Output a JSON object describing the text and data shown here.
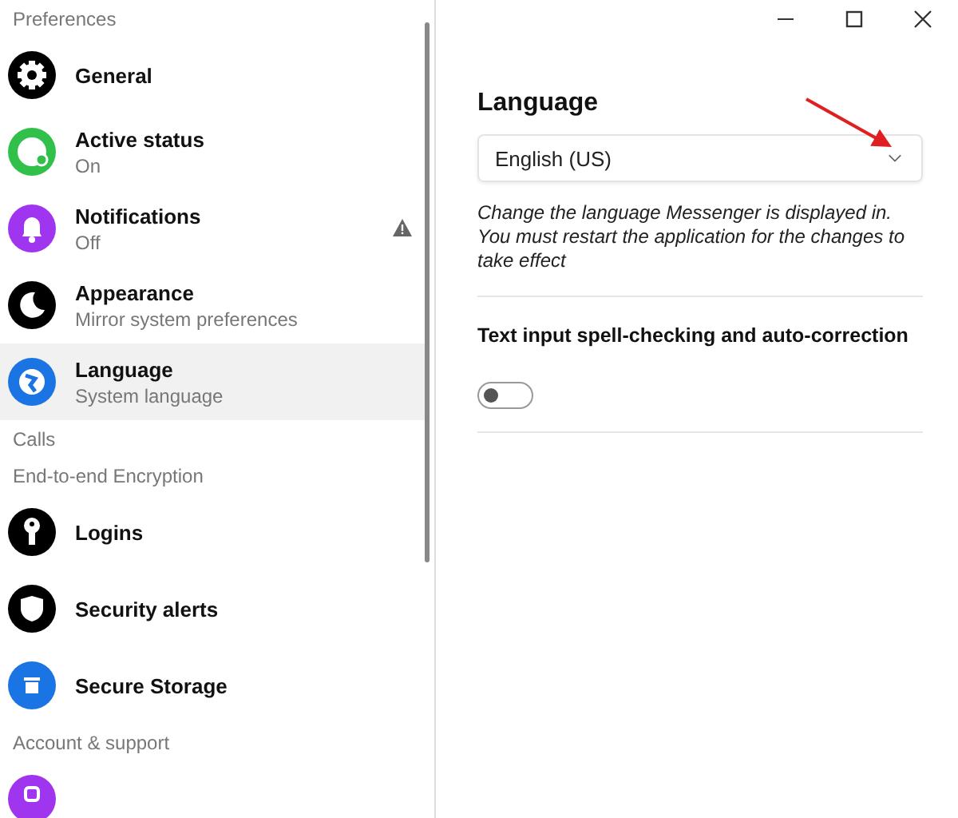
{
  "sidebar": {
    "items": [
      {
        "kind": "header",
        "title": "Preferences"
      },
      {
        "kind": "item",
        "title": "General",
        "color": "#000000",
        "selected": false,
        "warning": false
      },
      {
        "kind": "item",
        "title": "Active status",
        "subtitle": "On",
        "color": "#31c14b",
        "selected": false,
        "warning": false
      },
      {
        "kind": "item",
        "title": "Notifications",
        "subtitle": "Off",
        "color": "#a035f0",
        "selected": false,
        "warning": true
      },
      {
        "kind": "item",
        "title": "Appearance",
        "subtitle": "Mirror system preferences",
        "color": "#000000",
        "selected": false,
        "warning": false
      },
      {
        "kind": "item",
        "title": "Language",
        "subtitle": "System language",
        "color": "#1b74e4",
        "selected": true,
        "warning": false
      },
      {
        "kind": "header",
        "title": "Calls"
      },
      {
        "kind": "header",
        "title": "End-to-end Encryption"
      },
      {
        "kind": "item",
        "title": "Logins",
        "color": "#000000",
        "selected": false,
        "warning": false
      },
      {
        "kind": "item",
        "title": "Security alerts",
        "color": "#000000",
        "selected": false,
        "warning": false
      },
      {
        "kind": "item",
        "title": "Secure Storage",
        "color": "#1b74e4",
        "selected": false,
        "warning": false
      },
      {
        "kind": "header",
        "title": "Account & support"
      },
      {
        "kind": "item",
        "color": "#a035f0",
        "selected": false,
        "warning": false
      }
    ]
  },
  "panel": {
    "title": "Language",
    "dropdown": {
      "value": "English (US)"
    },
    "description": "Change the language Messenger is displayed in. You must restart the application for the changes to take effect",
    "spellcheck": {
      "label": "Text input spell-checking and auto-correction",
      "on": false
    }
  }
}
